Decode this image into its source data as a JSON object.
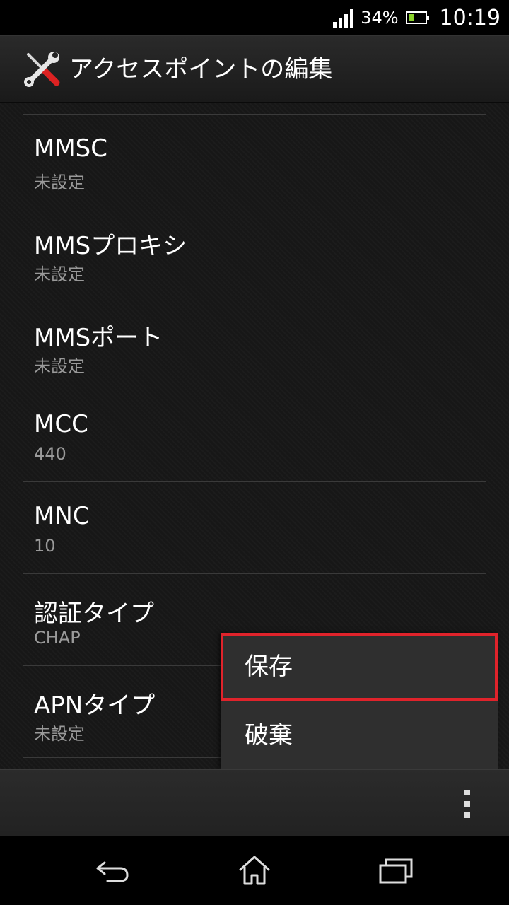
{
  "status_bar": {
    "battery_percent": "34%",
    "battery_level": 0.34,
    "time": "10:19",
    "icons": [
      "signal-icon",
      "battery-icon"
    ]
  },
  "action_bar": {
    "title": "アクセスポイントの編集",
    "app_icon": "wrench-screwdriver-icon"
  },
  "settings": [
    {
      "title": "MMSC",
      "value": "未設定"
    },
    {
      "title": "MMSプロキシ",
      "value": "未設定"
    },
    {
      "title": "MMSポート",
      "value": "未設定"
    },
    {
      "title": "MCC",
      "value": "440"
    },
    {
      "title": "MNC",
      "value": "10"
    },
    {
      "title": "認証タイプ",
      "value": "CHAP"
    },
    {
      "title": "APNタイプ",
      "value": "未設定"
    }
  ],
  "menu": {
    "save_label": "保存",
    "discard_label": "破棄",
    "highlight_color": "#e0232b"
  },
  "bottom_bar": {
    "overflow_icon": "more-vertical-icon"
  },
  "nav_bar": {
    "icons": [
      "back-icon",
      "home-icon",
      "recent-apps-icon"
    ]
  }
}
